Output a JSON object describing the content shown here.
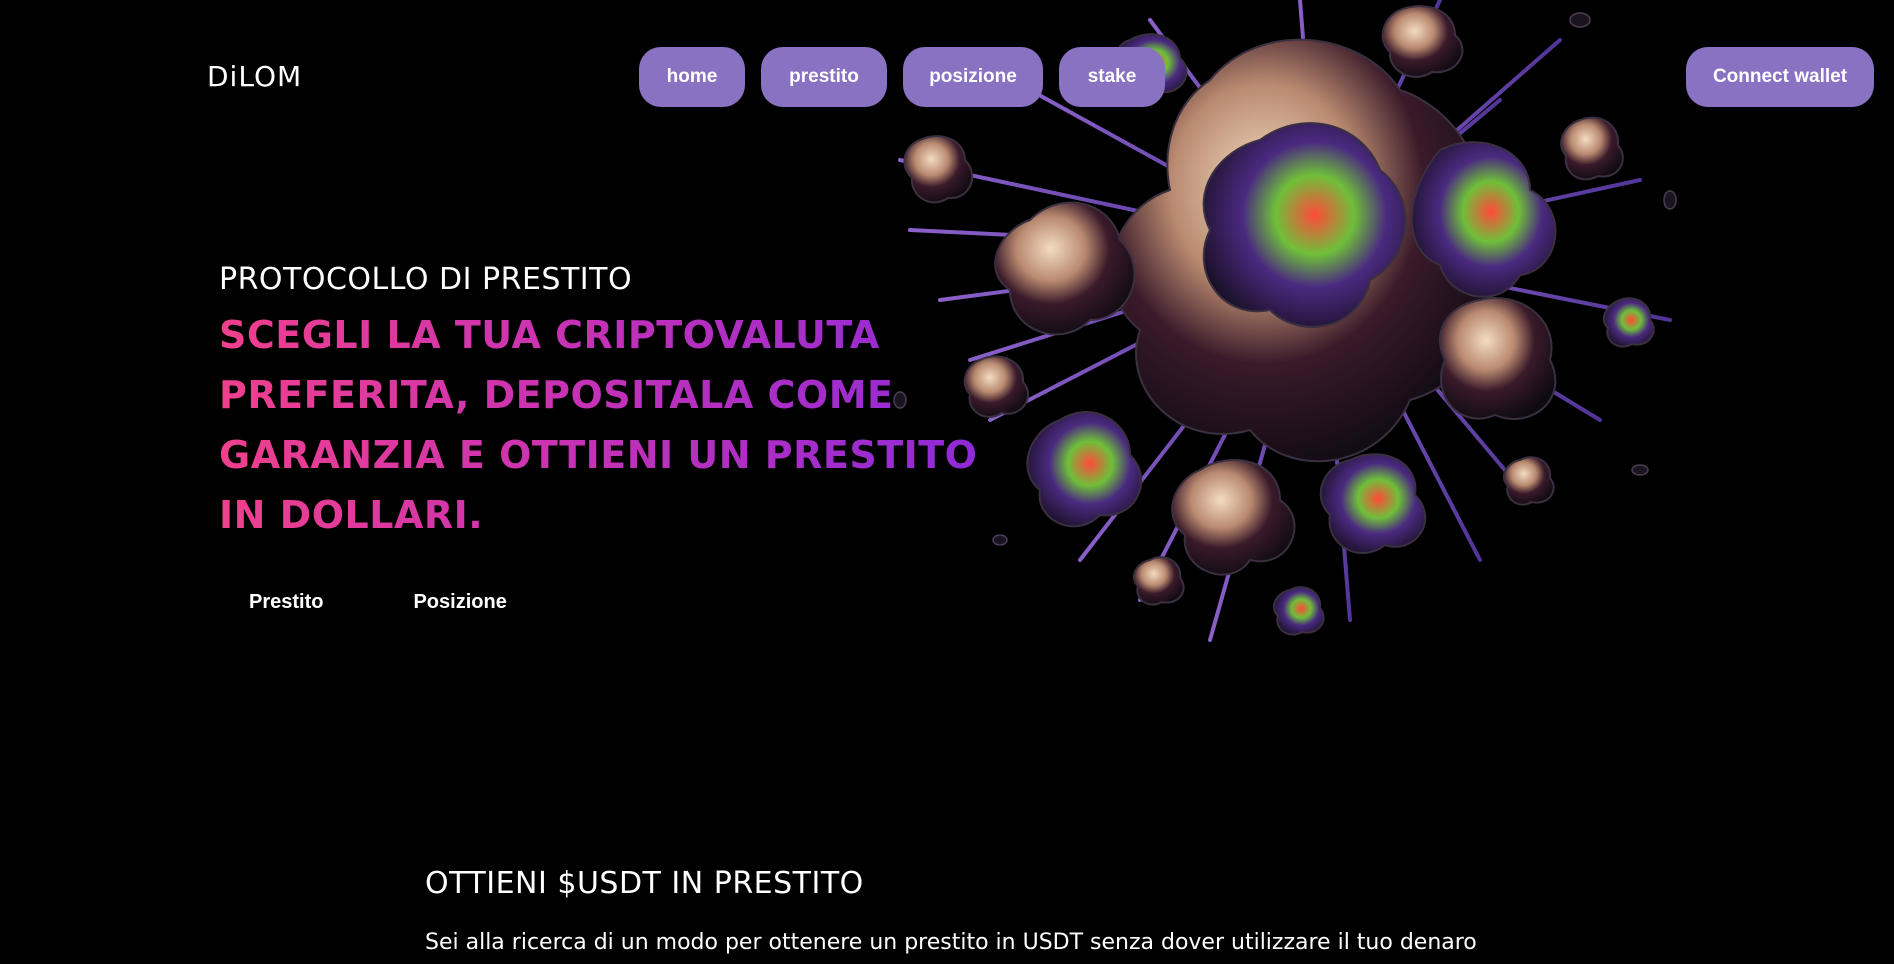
{
  "header": {
    "logo": "DiLOM",
    "nav": {
      "home": "home",
      "prestito": "prestito",
      "posizione": "posizione",
      "stake": "stake"
    },
    "connect_wallet": "Connect wallet"
  },
  "hero": {
    "eyebrow": "PROTOCOLLO DI PRESTITO",
    "title": "SCEGLI LA TUA CRIPTOVALUTA PREFERITA, DEPOSITALA COME GARANZIA E OTTIENI UN PRESTITO IN DOLLARI.",
    "links": {
      "prestito": "Prestito",
      "posizione": "Posizione"
    }
  },
  "section": {
    "title": "OTTIENI $USDT IN PRESTITO",
    "text": "Sei alla ricerca di un modo per ottenere un prestito in USDT senza dover utilizzare il tuo denaro"
  },
  "colors": {
    "background": "#000000",
    "button": "#8a72c2",
    "gradient_start": "#f0408c",
    "gradient_end": "#8e2ad8"
  },
  "icons": {
    "hero_art": "abstract-iridescent-splash"
  }
}
